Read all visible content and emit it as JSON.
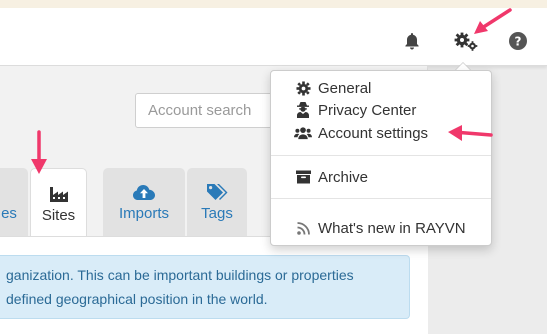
{
  "header": {
    "icons": [
      "bell-icon",
      "gears-icon",
      "question-circle-icon"
    ]
  },
  "search": {
    "placeholder": "Account search"
  },
  "tabs": [
    {
      "label": "es",
      "icon": "",
      "active": false
    },
    {
      "label": "Sites",
      "icon": "industry-icon",
      "active": true
    },
    {
      "label": "Imports",
      "icon": "cloud-upload-icon",
      "active": false
    },
    {
      "label": "Tags",
      "icon": "tags-icon",
      "active": false
    }
  ],
  "info": {
    "line1": "ganization. This can be important buildings or properties",
    "line2": "defined geographical position in the world."
  },
  "menu": {
    "items": [
      {
        "label": "General",
        "icon": "gear-icon"
      },
      {
        "label": "Privacy Center",
        "icon": "user-secret-icon"
      },
      {
        "label": "Account settings",
        "icon": "users-icon"
      },
      {
        "label": "Archive",
        "icon": "archive-icon"
      },
      {
        "label": "What's new in RAYVN",
        "icon": "rss-icon"
      }
    ]
  },
  "colors": {
    "annotation_arrow": "#f0386b",
    "link_blue": "#2a7ab8",
    "info_bg": "#d9ecf8",
    "info_text": "#2b6a96"
  }
}
